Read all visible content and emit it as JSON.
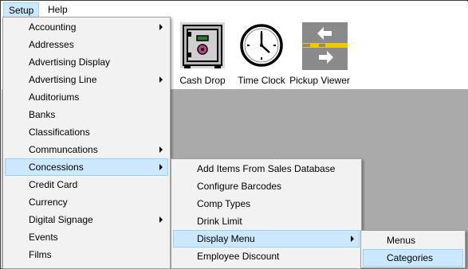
{
  "menubar": {
    "items": [
      {
        "label": "Setup"
      },
      {
        "label": "Help"
      }
    ]
  },
  "toolbar": {
    "buttons": [
      {
        "label": "Cash Drop",
        "icon": "safe-icon"
      },
      {
        "label": "Time Clock",
        "icon": "clock-icon"
      },
      {
        "label": "Pickup Viewer",
        "icon": "arrows-icon"
      }
    ]
  },
  "setup_menu": {
    "items": [
      {
        "label": "Accounting",
        "submenu": true
      },
      {
        "label": "Addresses",
        "submenu": false
      },
      {
        "label": "Advertising Display",
        "submenu": false
      },
      {
        "label": "Advertising Line",
        "submenu": true
      },
      {
        "label": "Auditoriums",
        "submenu": false
      },
      {
        "label": "Banks",
        "submenu": false
      },
      {
        "label": "Classifications",
        "submenu": false
      },
      {
        "label": "Communcations",
        "submenu": true
      },
      {
        "label": "Concessions",
        "submenu": true
      },
      {
        "label": "Credit Card",
        "submenu": false
      },
      {
        "label": "Currency",
        "submenu": false
      },
      {
        "label": "Digital Signage",
        "submenu": true
      },
      {
        "label": "Events",
        "submenu": false
      },
      {
        "label": "Films",
        "submenu": false
      }
    ]
  },
  "concessions_menu": {
    "items": [
      {
        "label": "Add Items From Sales Database",
        "submenu": false
      },
      {
        "label": "Configure Barcodes",
        "submenu": false
      },
      {
        "label": "Comp Types",
        "submenu": false
      },
      {
        "label": "Drink Limit",
        "submenu": false
      },
      {
        "label": "Display Menu",
        "submenu": true
      },
      {
        "label": "Employee Discount",
        "submenu": false
      }
    ]
  },
  "display_menu": {
    "items": [
      {
        "label": "Menus"
      },
      {
        "label": "Categories"
      }
    ]
  },
  "colors": {
    "menu_highlight": "#cce8ff",
    "menu_highlight_border": "#99d1ff",
    "menu_background": "#f2f2f2",
    "workspace": "#aaaaaa"
  }
}
